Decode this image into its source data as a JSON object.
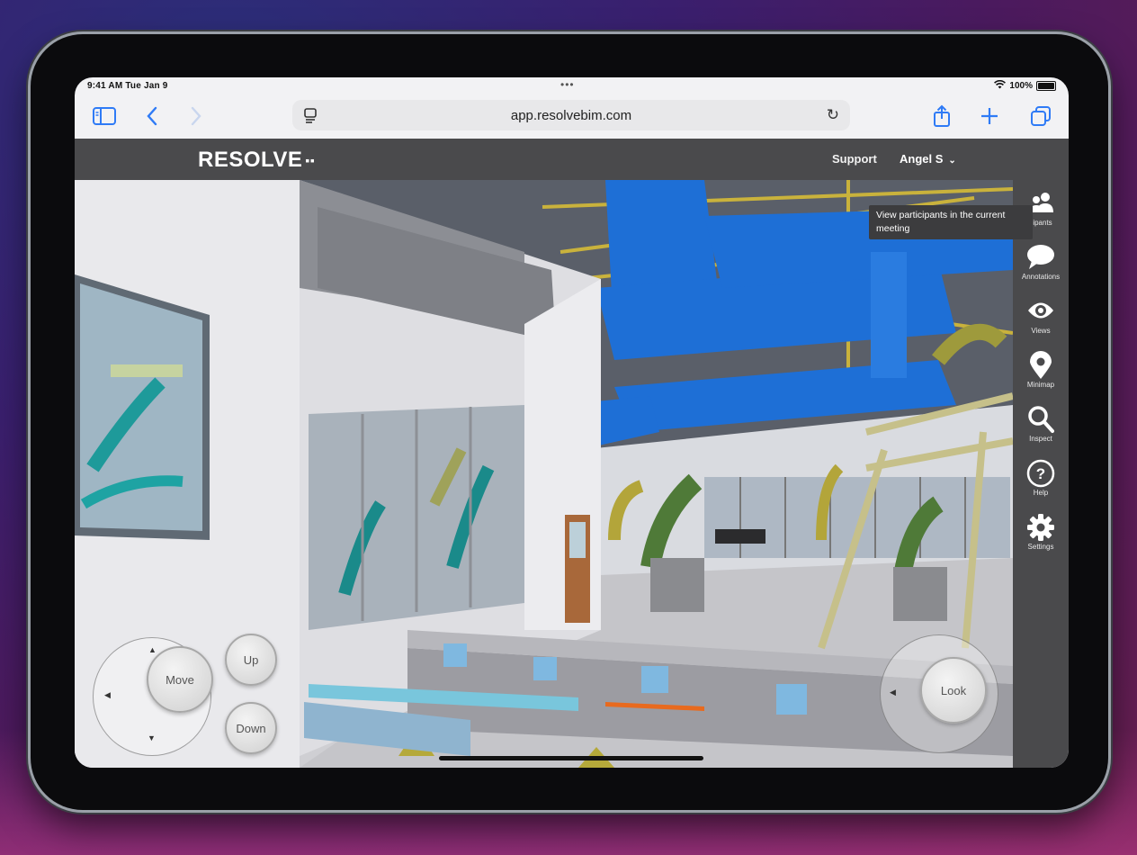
{
  "status_bar": {
    "time_date": "9:41 AM  Tue Jan 9",
    "dots": "•••",
    "battery": "100%",
    "wifi_icon": "wifi-icon"
  },
  "browser": {
    "url": "app.resolvebim.com",
    "icons": [
      "sidebar-icon",
      "back-icon",
      "forward-icon",
      "reader-icon",
      "reload-icon",
      "share-icon",
      "new-tab-icon",
      "tabs-icon"
    ]
  },
  "app_header": {
    "logo": "RESOLVE",
    "support": "Support",
    "user": "Angel S"
  },
  "side_panel": {
    "items": [
      {
        "label": "cipants",
        "icon": "participants-icon"
      },
      {
        "label": "Annotations",
        "icon": "annotations-icon"
      },
      {
        "label": "Views",
        "icon": "views-icon"
      },
      {
        "label": "Minimap",
        "icon": "minimap-icon"
      },
      {
        "label": "Inspect",
        "icon": "inspect-icon"
      },
      {
        "label": "Help",
        "icon": "help-icon"
      },
      {
        "label": "Settings",
        "icon": "settings-icon"
      }
    ],
    "tooltip": "View participants in the current meeting"
  },
  "controls": {
    "move": "Move",
    "up": "Up",
    "down": "Down",
    "look": "Look"
  },
  "colors": {
    "header_bg": "#4a4a4c",
    "accent_blue": "#2f7bf6",
    "duct_blue": "#1e6fd6"
  }
}
